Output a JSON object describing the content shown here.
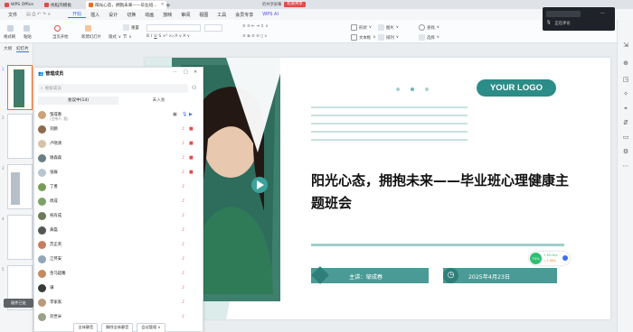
{
  "titlebar": {
    "tabs": [
      {
        "label": "WPS Office",
        "color": "#e24b4b"
      },
      {
        "label": "找稻壳模板",
        "color": "#e24b4b"
      },
      {
        "label": "阳光心态，拥抱未来——毕业班...",
        "color": "#f26b1d"
      }
    ],
    "share_label": "的共享屏幕",
    "share_status": "结束共享"
  },
  "menu": {
    "file": "文件",
    "items": [
      "开始",
      "插入",
      "设计",
      "切换",
      "动画",
      "放映",
      "审阅",
      "视图",
      "工具",
      "会员专享",
      "WPS AI"
    ],
    "active": "开始"
  },
  "ribbon": {
    "format_painter": "格式刷",
    "paste": "粘贴",
    "current_start": "当页开始",
    "new_slide": "新建幻灯片",
    "layout": "版式",
    "section": "节",
    "reset": "重置",
    "font": "",
    "shape": "形状",
    "picture": "图片",
    "textbox": "文本框",
    "arrange": "排列",
    "find": "查找",
    "select": "选择"
  },
  "left_panel": {
    "tab_outline": "大纲",
    "tab_slides": "幻灯片",
    "slide_numbers": [
      "1",
      "2",
      "3",
      "4",
      "5"
    ]
  },
  "participants": {
    "title": "管理成员",
    "search_placeholder": "搜索成员",
    "tab_in_meeting": "会议中(14)",
    "tab_not_joined": "未入会",
    "members": [
      {
        "name": "邹成春",
        "sub": "(主持人, 我)",
        "color": "#c9a27a"
      },
      {
        "name": "刘鹏",
        "sub": "",
        "color": "#8b6b50"
      },
      {
        "name": "卢晓清",
        "sub": "",
        "color": "#d7c1a8"
      },
      {
        "name": "谢森森",
        "sub": "",
        "color": "#6b7e86"
      },
      {
        "name": "张群",
        "sub": "",
        "color": "#b8c6d0"
      },
      {
        "name": "丁勇",
        "sub": "",
        "color": "#7a9c5a"
      },
      {
        "name": "周成",
        "sub": "",
        "color": "#7ea06a"
      },
      {
        "name": "祝有成",
        "sub": "",
        "color": "#6d7a5a"
      },
      {
        "name": "黄磊",
        "sub": "",
        "color": "#555555"
      },
      {
        "name": "苏正英",
        "sub": "",
        "color": "#c77e5e"
      },
      {
        "name": "江怀安",
        "sub": "",
        "color": "#8fa7b9"
      },
      {
        "name": "金马超雕",
        "sub": "",
        "color": "#c28a5f"
      },
      {
        "name": "谦",
        "sub": "",
        "color": "#3a3a3a"
      },
      {
        "name": "李家家",
        "sub": "",
        "color": "#b99a7e"
      },
      {
        "name": "刘世米",
        "sub": "",
        "color": "#9aa08a"
      }
    ],
    "buttons": [
      "全体静音",
      "解除全体静音",
      "会议管理 ∨"
    ]
  },
  "slide": {
    "logo": "YOUR LOGO",
    "title": "阳光心态，拥抱未来——毕业班心理健康主题班会",
    "speaker": "主讲：邹成春",
    "date": "2025年4月23日"
  },
  "share_window": {
    "label": "正在评论"
  },
  "battery": {
    "percent": "75%",
    "stat1": "↑ 69.2K/s",
    "stat2": "↓ 1.8K/s"
  },
  "bottom_hint": "插件已处"
}
